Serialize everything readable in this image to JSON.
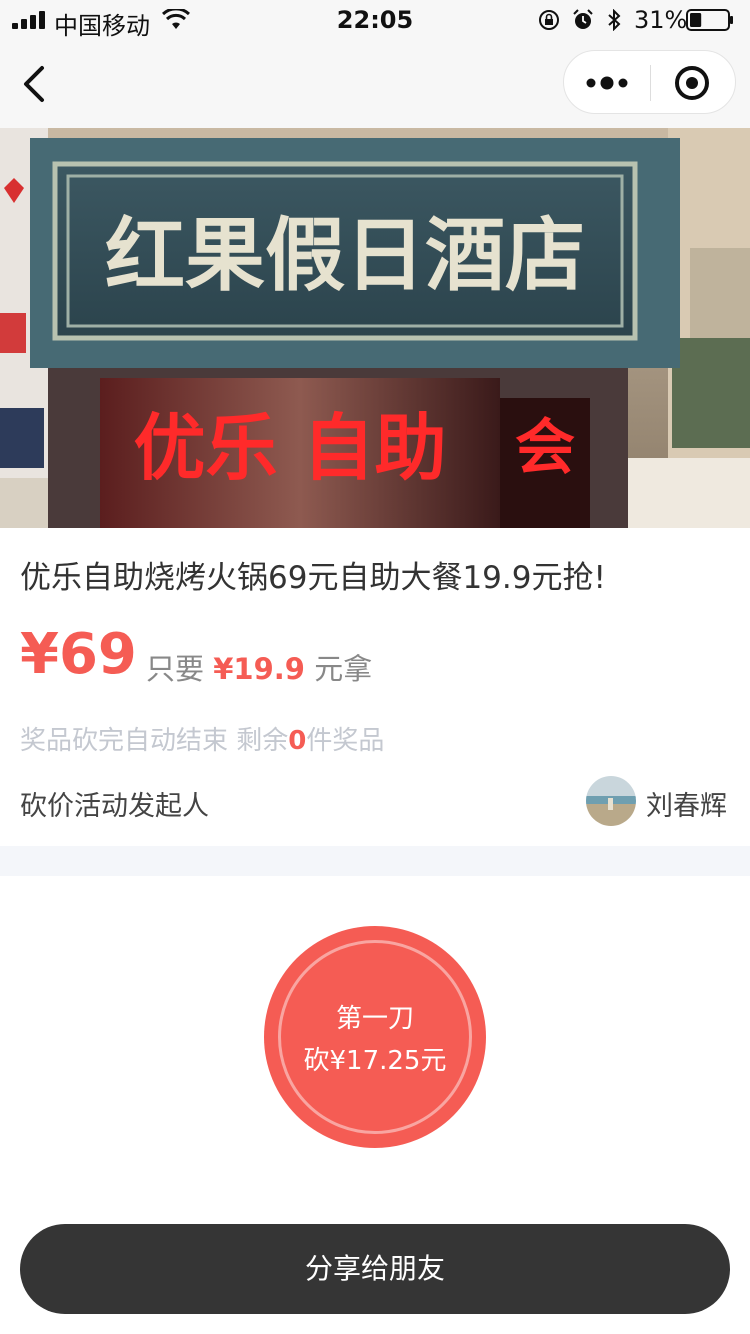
{
  "status_bar": {
    "carrier": "中国移动",
    "time": "22:05",
    "battery_percent": "31%",
    "battery_level": 0.31,
    "icons": [
      "signal-icon",
      "wifi-icon",
      "rotation-lock-icon",
      "alarm-icon",
      "bluetooth-icon",
      "battery-icon"
    ]
  },
  "nav": {
    "icons": [
      "back-icon",
      "more-icon",
      "close-miniprogram-icon"
    ]
  },
  "banner": {
    "sign_text": "红果假日酒店",
    "neon_text": "优乐 自助",
    "side_neon_text": "会"
  },
  "product": {
    "title": "优乐自助烧烤火锅69元自助大餐19.9元抢!",
    "original_price": "¥69",
    "need_prefix": "只要",
    "target_price": "¥19.9",
    "need_suffix": "元拿",
    "remain_prefix": "奖品砍完自动结束 剩余",
    "remain_count": "0",
    "remain_suffix": "件奖品"
  },
  "initiator": {
    "label": "砍价活动发起人",
    "name": "刘春辉"
  },
  "cut_button": {
    "line1": "第一刀",
    "line2": "砍¥17.25元"
  },
  "share_button": {
    "label": "分享给朋友"
  },
  "colors": {
    "accent": "#f55c54",
    "dark_button": "#353535",
    "muted_text": "#c4c8d0"
  }
}
